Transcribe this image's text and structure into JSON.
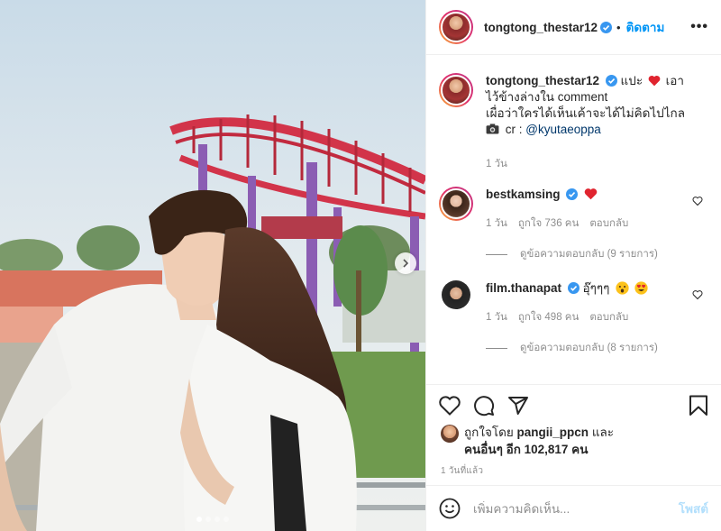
{
  "header": {
    "username": "tongtong_thestar12",
    "separator": "•",
    "follow_label": "ติดตาม",
    "more_label": "•••"
  },
  "caption": {
    "username": "tongtong_thestar12",
    "text_before_heart": "แปะ",
    "text_after_heart": "เอาไว้ข้างล่างใน comment",
    "line2": "เผื่อว่าใครได้เห็นเค้าจะได้ไม่คิดไปไกล",
    "credit_prefix": "cr :",
    "credit_mention": "@kyutaeoppa",
    "time": "1 วัน"
  },
  "comments": [
    {
      "username": "bestkamsing",
      "text": "",
      "time": "1 วัน",
      "likes": "ถูกใจ 736 คน",
      "reply_label": "ตอบกลับ",
      "view_replies": "ดูข้อความตอบกลับ (9 รายการ)"
    },
    {
      "username": "film.thanapat",
      "text": "อุ๊ๆๆๆ",
      "time": "1 วัน",
      "likes": "ถูกใจ 498 คน",
      "reply_label": "ตอบกลับ",
      "view_replies": "ดูข้อความตอบกลับ (8 รายการ)"
    }
  ],
  "likes_summary": {
    "prefix": "ถูกใจโดย",
    "user": "pangii_ppcn",
    "joiner": "และ",
    "others": "คนอื่นๆ อีก 102,817 คน"
  },
  "time_ago": "1 วันที่แล้ว",
  "composer": {
    "placeholder": "เพิ่มความคิดเห็น...",
    "post_label": "โพสต์"
  },
  "carousel": {
    "slide_count": 4,
    "active_index": 0
  },
  "colors": {
    "accent": "#0095f6",
    "verified": "#3897f0",
    "heart": "#ed4956",
    "link": "#00376b"
  },
  "icons": [
    "verified-badge-icon",
    "heart-icon",
    "comment-icon",
    "share-icon",
    "bookmark-icon",
    "emoji-icon",
    "camera-icon",
    "chevron-right-icon"
  ]
}
